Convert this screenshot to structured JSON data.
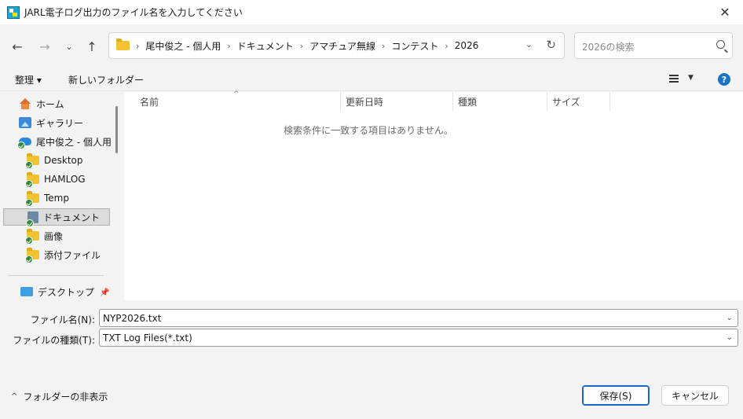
{
  "window": {
    "title": "JARL電子ログ出力のファイル名を入力してください",
    "close_glyph": "✕"
  },
  "navigation": {
    "back_icon": "arrow-left-icon",
    "forward_icon": "arrow-right-icon",
    "recent_icon": "chevron-down-icon",
    "up_icon": "arrow-up-icon",
    "breadcrumbs": [
      "尾中俊之 - 個人用",
      "ドキュメント",
      "アマチュア無線",
      "コンテスト",
      "2026"
    ],
    "search_placeholder": "2026の検索"
  },
  "commands": {
    "organize": "整理 ▾",
    "new_folder": "新しいフォルダー"
  },
  "sidebar": {
    "items": [
      {
        "label": "ホーム",
        "icon": "home-icon"
      },
      {
        "label": "ギャラリー",
        "icon": "gallery-icon"
      },
      {
        "label": "尾中俊之 - 個人用",
        "icon": "onedrive-icon"
      },
      {
        "label": "Desktop",
        "icon": "folder-icon"
      },
      {
        "label": "HAMLOG",
        "icon": "folder-icon"
      },
      {
        "label": "Temp",
        "icon": "folder-icon"
      },
      {
        "label": "ドキュメント",
        "icon": "documents-icon",
        "selected": true
      },
      {
        "label": "画像",
        "icon": "folder-icon"
      },
      {
        "label": "添付ファイル",
        "icon": "folder-icon"
      },
      {
        "label": "デスクトップ",
        "icon": "desktop-icon"
      }
    ]
  },
  "file_list": {
    "columns": [
      "名前",
      "更新日時",
      "種類",
      "サイズ"
    ],
    "empty_message": "検索条件に一致する項目はありません。"
  },
  "form": {
    "filename_label": "ファイル名(N):",
    "filename_value": "NYP2026.txt",
    "filetype_label": "ファイルの種類(T):",
    "filetype_value": "TXT Log Files(*.txt)"
  },
  "footer": {
    "hide_folders": "フォルダーの非表示",
    "save_label": "保存(S)",
    "cancel_label": "キャンセル"
  },
  "colors": {
    "accent": "#1a66c7",
    "help": "#1a73c9"
  }
}
